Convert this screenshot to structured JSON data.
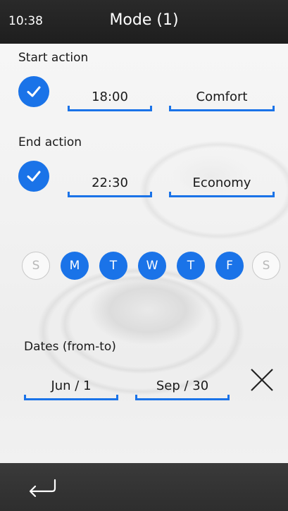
{
  "status": {
    "time": "10:38",
    "title": "Mode (1)"
  },
  "start_action": {
    "label": "Start action",
    "checked": true,
    "time": "18:00",
    "mode": "Comfort"
  },
  "end_action": {
    "label": "End action",
    "checked": true,
    "time": "22:30",
    "mode": "Economy"
  },
  "days": [
    {
      "letter": "S",
      "active": false
    },
    {
      "letter": "M",
      "active": true
    },
    {
      "letter": "T",
      "active": true
    },
    {
      "letter": "W",
      "active": true
    },
    {
      "letter": "T",
      "active": true
    },
    {
      "letter": "F",
      "active": true
    },
    {
      "letter": "S",
      "active": false
    }
  ],
  "dates": {
    "label": "Dates (from-to)",
    "from": "Jun / 1",
    "to": "Sep / 30"
  },
  "colors": {
    "accent": "#1a73e8",
    "bar": "#2a2a2a"
  },
  "icons": {
    "check": "check-icon",
    "clear": "close-icon",
    "back": "return-arrow-icon"
  }
}
